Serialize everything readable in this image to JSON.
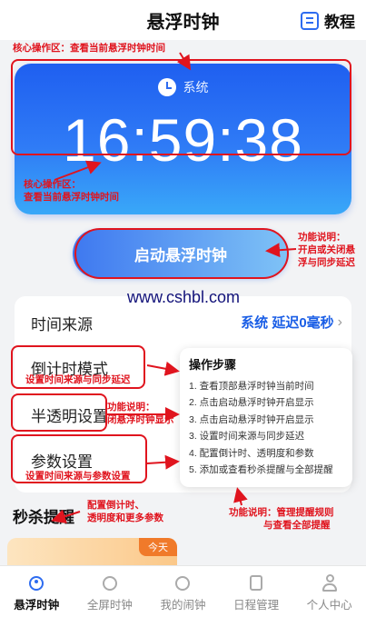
{
  "header": {
    "title": "悬浮时钟",
    "tutorial_label": "教程"
  },
  "clock": {
    "source_label": "系统",
    "time": "16:59:38"
  },
  "start_button": {
    "label": "启动悬浮时钟"
  },
  "watermark": "www.cshbl.com",
  "settings": {
    "time_source_label": "时间来源",
    "time_source_value": "系统 延迟0毫秒",
    "countdown_label": "倒计时模式",
    "translucent_label": "半透明设置",
    "params_label": "参数设置"
  },
  "steps": {
    "title": "操作步骤",
    "items": [
      "1. 查看顶部悬浮时钟当前时间",
      "2. 点击启动悬浮时钟开启显示",
      "3. 点击启动悬浮时钟开启显示",
      "3. 设置时间来源与同步延迟",
      "4. 配置倒计时、透明度和参数",
      "5. 添加或查看秒杀提醒与全部提醒"
    ]
  },
  "seckill": {
    "title": "秒杀提醒",
    "badge": "今天"
  },
  "annotations": {
    "top": "核心操作区：查看当前悬浮时钟时间",
    "bottom_line1": "核心操作区：",
    "bottom_line2": "查看当前悬浮时钟时间",
    "func1_line1": "功能说明：",
    "func1_line2": "开启或关闭悬",
    "func1_line3": "浮与同步延迟",
    "countdown_note": "设置时间来源与同步延迟",
    "func2_line1": "功能说明：",
    "func2_line2": "闭悬浮时钟显示",
    "params_note": "设置时间来源与参数设置",
    "config_line1": "配置倒计时、",
    "config_line2": "透明度和更多参数",
    "func3_line1": "功能说明：管理提醒规则",
    "func3_line2": "与查看全部提醒"
  },
  "tabs": [
    {
      "label": "悬浮时钟",
      "icon": "alarm-clock-icon",
      "active": true
    },
    {
      "label": "全屏时钟",
      "icon": "clock-icon",
      "active": false
    },
    {
      "label": "我的闹钟",
      "icon": "alarm-icon",
      "active": false
    },
    {
      "label": "日程管理",
      "icon": "schedule-icon",
      "active": false
    },
    {
      "label": "个人中心",
      "icon": "person-icon",
      "active": false
    }
  ],
  "colors": {
    "accent": "#2e6cf0",
    "annotation": "#e0141e",
    "value_blue": "#1a5ee6"
  }
}
